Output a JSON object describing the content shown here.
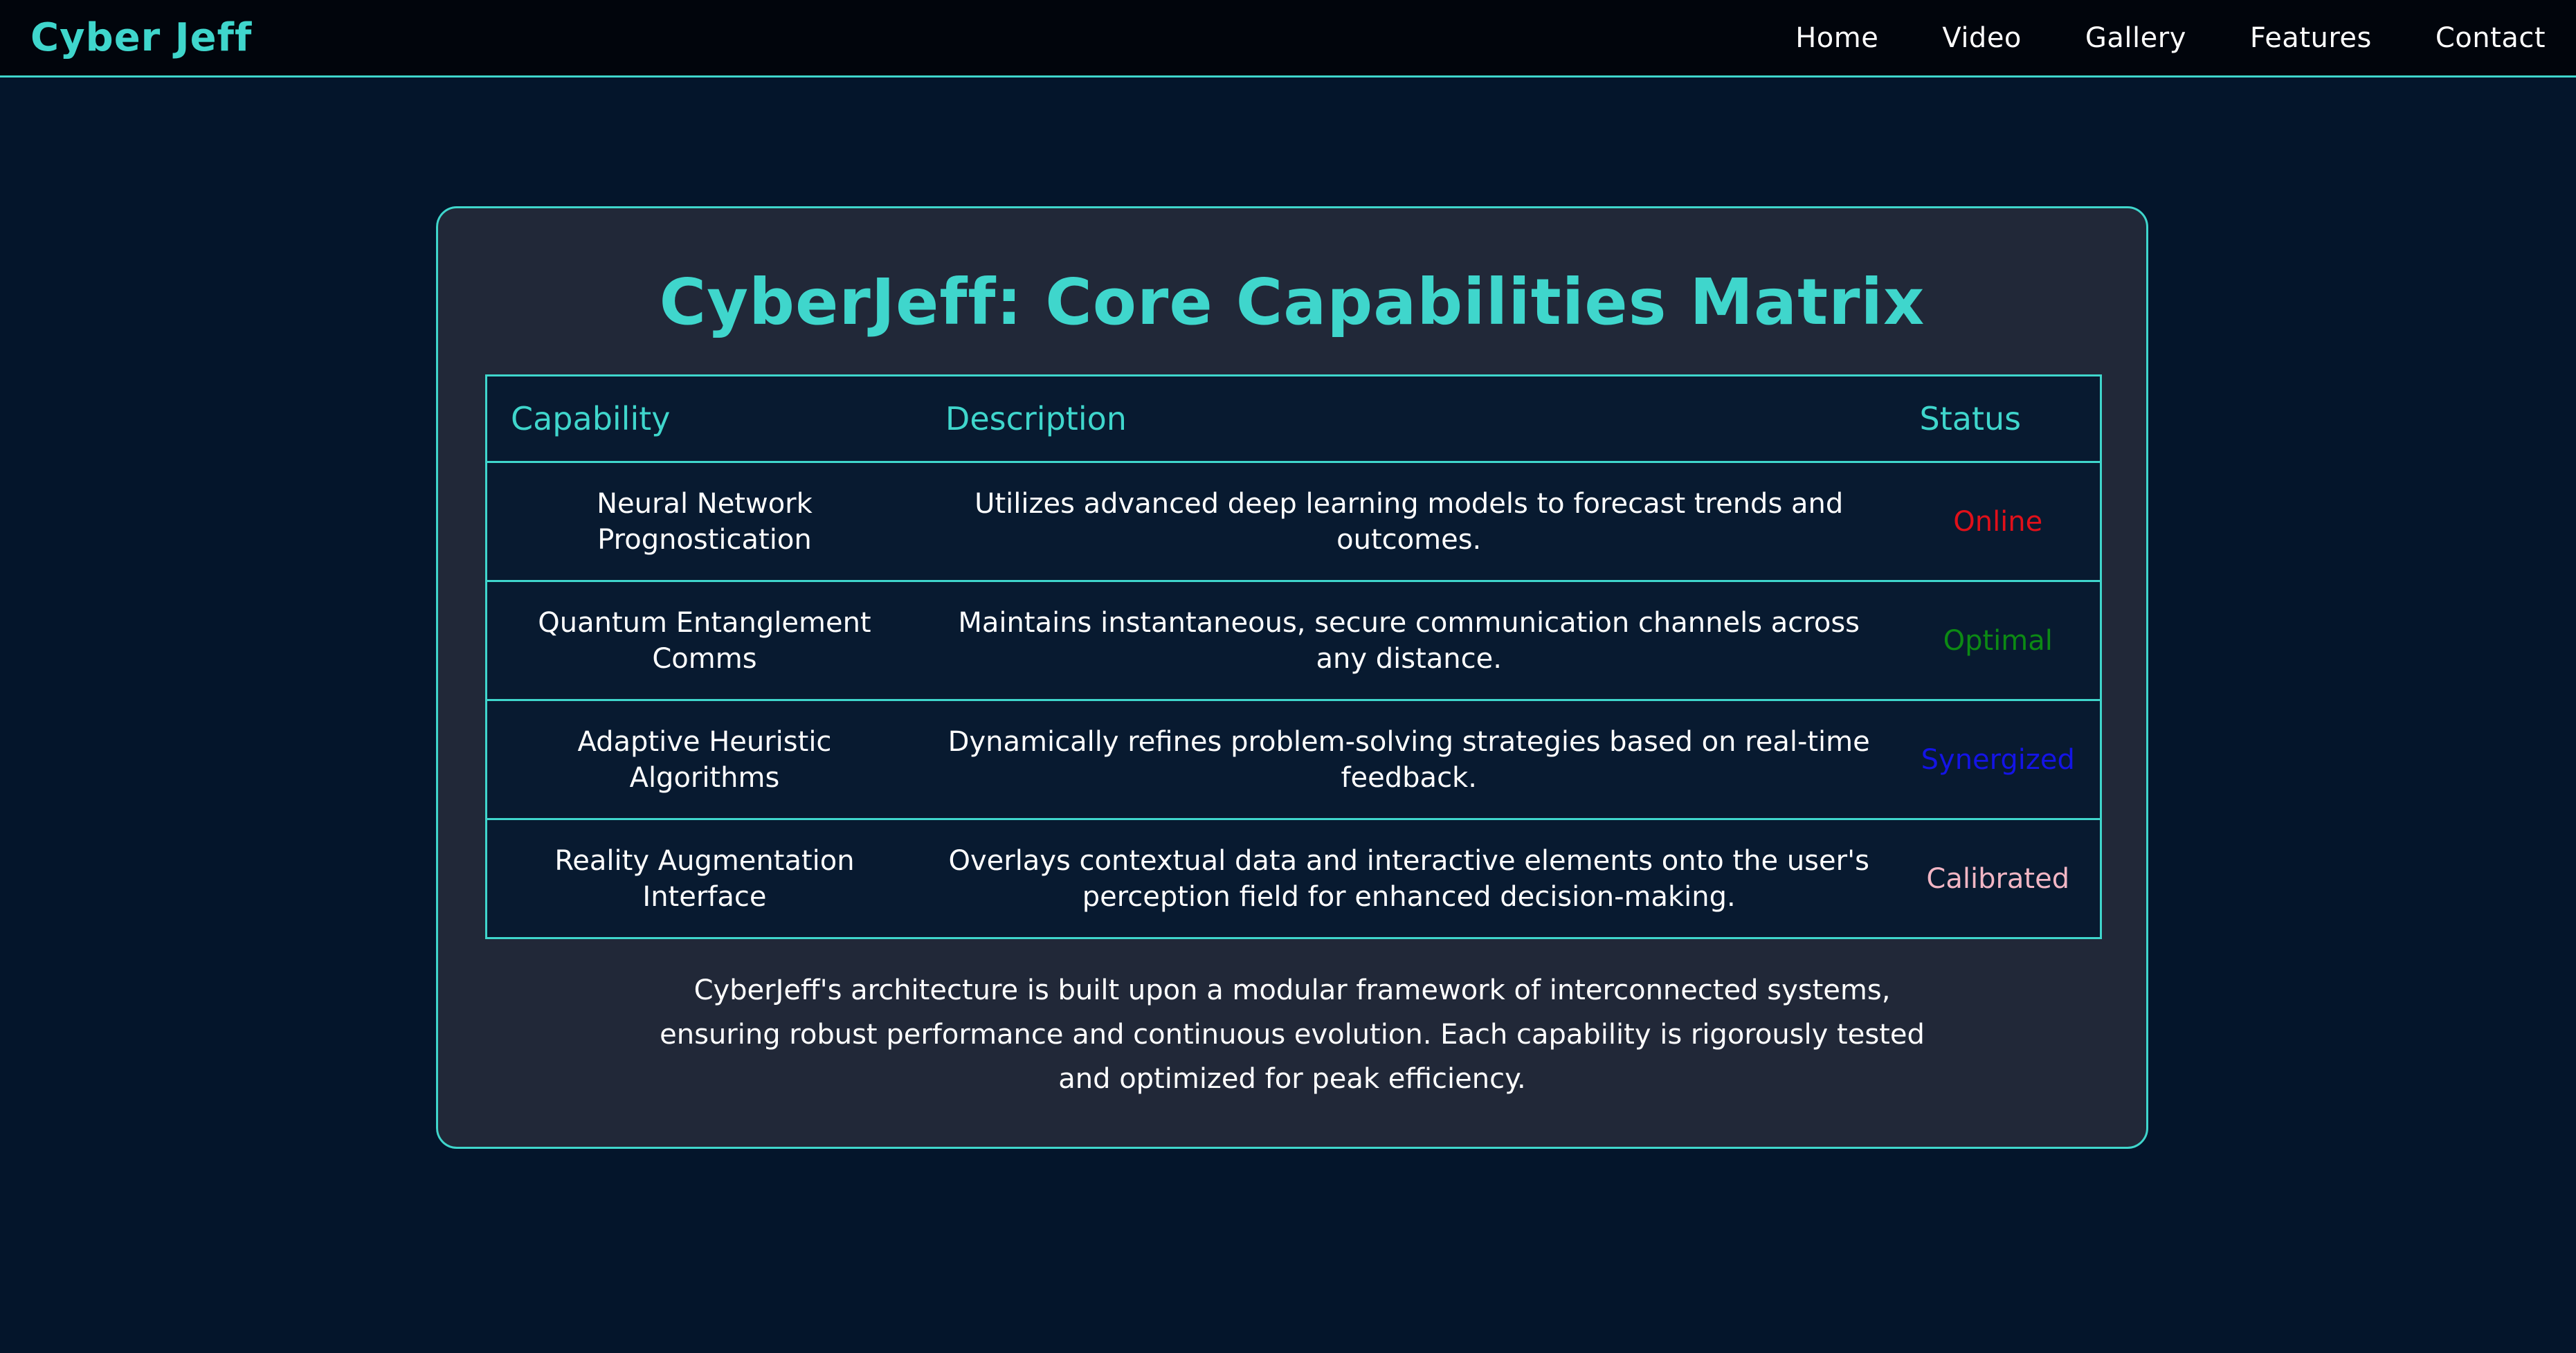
{
  "nav": {
    "brand": "Cyber Jeff",
    "links": [
      "Home",
      "Video",
      "Gallery",
      "Features",
      "Contact"
    ]
  },
  "panel": {
    "title": "CyberJeff: Core Capabilities Matrix",
    "table": {
      "headers": [
        "Capability",
        "Description",
        "Status"
      ],
      "rows": [
        {
          "capability": "Neural Network Prognostication",
          "description": "Utilizes advanced deep learning models to forecast trends and outcomes.",
          "status": "Online",
          "status_color": "#e0101a"
        },
        {
          "capability": "Quantum Entanglement Comms",
          "description": "Maintains instantaneous, secure communication channels across any distance.",
          "status": "Optimal",
          "status_color": "#0c8a14"
        },
        {
          "capability": "Adaptive Heuristic Algorithms",
          "description": "Dynamically refines problem-solving strategies based on real-time feedback.",
          "status": "Synergized",
          "status_color": "#1414e6"
        },
        {
          "capability": "Reality Augmentation Interface",
          "description": "Overlays contextual data and interactive elements onto the user's perception field for enhanced decision-making.",
          "status": "Calibrated",
          "status_color": "#f2b6c4"
        }
      ]
    },
    "footer": "CyberJeff's architecture is built upon a modular framework of interconnected systems, ensuring robust performance and continuous evolution. Each capability is rigorously tested and optimized for peak efficiency."
  },
  "colors": {
    "accent": "#3fd6cc",
    "background": "#04152b",
    "panel": "#212838",
    "navbar": "#01050c"
  }
}
